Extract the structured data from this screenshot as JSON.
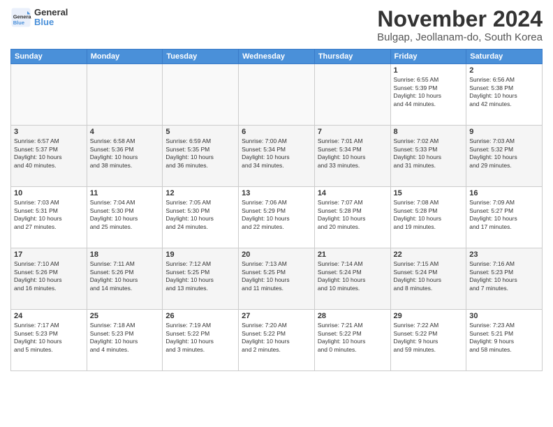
{
  "logo": {
    "general": "General",
    "blue": "Blue"
  },
  "title": "November 2024",
  "location": "Bulgap, Jeollanam-do, South Korea",
  "weekdays": [
    "Sunday",
    "Monday",
    "Tuesday",
    "Wednesday",
    "Thursday",
    "Friday",
    "Saturday"
  ],
  "weeks": [
    [
      {
        "day": "",
        "info": ""
      },
      {
        "day": "",
        "info": ""
      },
      {
        "day": "",
        "info": ""
      },
      {
        "day": "",
        "info": ""
      },
      {
        "day": "",
        "info": ""
      },
      {
        "day": "1",
        "info": "Sunrise: 6:55 AM\nSunset: 5:39 PM\nDaylight: 10 hours\nand 44 minutes."
      },
      {
        "day": "2",
        "info": "Sunrise: 6:56 AM\nSunset: 5:38 PM\nDaylight: 10 hours\nand 42 minutes."
      }
    ],
    [
      {
        "day": "3",
        "info": "Sunrise: 6:57 AM\nSunset: 5:37 PM\nDaylight: 10 hours\nand 40 minutes."
      },
      {
        "day": "4",
        "info": "Sunrise: 6:58 AM\nSunset: 5:36 PM\nDaylight: 10 hours\nand 38 minutes."
      },
      {
        "day": "5",
        "info": "Sunrise: 6:59 AM\nSunset: 5:35 PM\nDaylight: 10 hours\nand 36 minutes."
      },
      {
        "day": "6",
        "info": "Sunrise: 7:00 AM\nSunset: 5:34 PM\nDaylight: 10 hours\nand 34 minutes."
      },
      {
        "day": "7",
        "info": "Sunrise: 7:01 AM\nSunset: 5:34 PM\nDaylight: 10 hours\nand 33 minutes."
      },
      {
        "day": "8",
        "info": "Sunrise: 7:02 AM\nSunset: 5:33 PM\nDaylight: 10 hours\nand 31 minutes."
      },
      {
        "day": "9",
        "info": "Sunrise: 7:03 AM\nSunset: 5:32 PM\nDaylight: 10 hours\nand 29 minutes."
      }
    ],
    [
      {
        "day": "10",
        "info": "Sunrise: 7:03 AM\nSunset: 5:31 PM\nDaylight: 10 hours\nand 27 minutes."
      },
      {
        "day": "11",
        "info": "Sunrise: 7:04 AM\nSunset: 5:30 PM\nDaylight: 10 hours\nand 25 minutes."
      },
      {
        "day": "12",
        "info": "Sunrise: 7:05 AM\nSunset: 5:30 PM\nDaylight: 10 hours\nand 24 minutes."
      },
      {
        "day": "13",
        "info": "Sunrise: 7:06 AM\nSunset: 5:29 PM\nDaylight: 10 hours\nand 22 minutes."
      },
      {
        "day": "14",
        "info": "Sunrise: 7:07 AM\nSunset: 5:28 PM\nDaylight: 10 hours\nand 20 minutes."
      },
      {
        "day": "15",
        "info": "Sunrise: 7:08 AM\nSunset: 5:28 PM\nDaylight: 10 hours\nand 19 minutes."
      },
      {
        "day": "16",
        "info": "Sunrise: 7:09 AM\nSunset: 5:27 PM\nDaylight: 10 hours\nand 17 minutes."
      }
    ],
    [
      {
        "day": "17",
        "info": "Sunrise: 7:10 AM\nSunset: 5:26 PM\nDaylight: 10 hours\nand 16 minutes."
      },
      {
        "day": "18",
        "info": "Sunrise: 7:11 AM\nSunset: 5:26 PM\nDaylight: 10 hours\nand 14 minutes."
      },
      {
        "day": "19",
        "info": "Sunrise: 7:12 AM\nSunset: 5:25 PM\nDaylight: 10 hours\nand 13 minutes."
      },
      {
        "day": "20",
        "info": "Sunrise: 7:13 AM\nSunset: 5:25 PM\nDaylight: 10 hours\nand 11 minutes."
      },
      {
        "day": "21",
        "info": "Sunrise: 7:14 AM\nSunset: 5:24 PM\nDaylight: 10 hours\nand 10 minutes."
      },
      {
        "day": "22",
        "info": "Sunrise: 7:15 AM\nSunset: 5:24 PM\nDaylight: 10 hours\nand 8 minutes."
      },
      {
        "day": "23",
        "info": "Sunrise: 7:16 AM\nSunset: 5:23 PM\nDaylight: 10 hours\nand 7 minutes."
      }
    ],
    [
      {
        "day": "24",
        "info": "Sunrise: 7:17 AM\nSunset: 5:23 PM\nDaylight: 10 hours\nand 5 minutes."
      },
      {
        "day": "25",
        "info": "Sunrise: 7:18 AM\nSunset: 5:23 PM\nDaylight: 10 hours\nand 4 minutes."
      },
      {
        "day": "26",
        "info": "Sunrise: 7:19 AM\nSunset: 5:22 PM\nDaylight: 10 hours\nand 3 minutes."
      },
      {
        "day": "27",
        "info": "Sunrise: 7:20 AM\nSunset: 5:22 PM\nDaylight: 10 hours\nand 2 minutes."
      },
      {
        "day": "28",
        "info": "Sunrise: 7:21 AM\nSunset: 5:22 PM\nDaylight: 10 hours\nand 0 minutes."
      },
      {
        "day": "29",
        "info": "Sunrise: 7:22 AM\nSunset: 5:22 PM\nDaylight: 9 hours\nand 59 minutes."
      },
      {
        "day": "30",
        "info": "Sunrise: 7:23 AM\nSunset: 5:21 PM\nDaylight: 9 hours\nand 58 minutes."
      }
    ]
  ]
}
